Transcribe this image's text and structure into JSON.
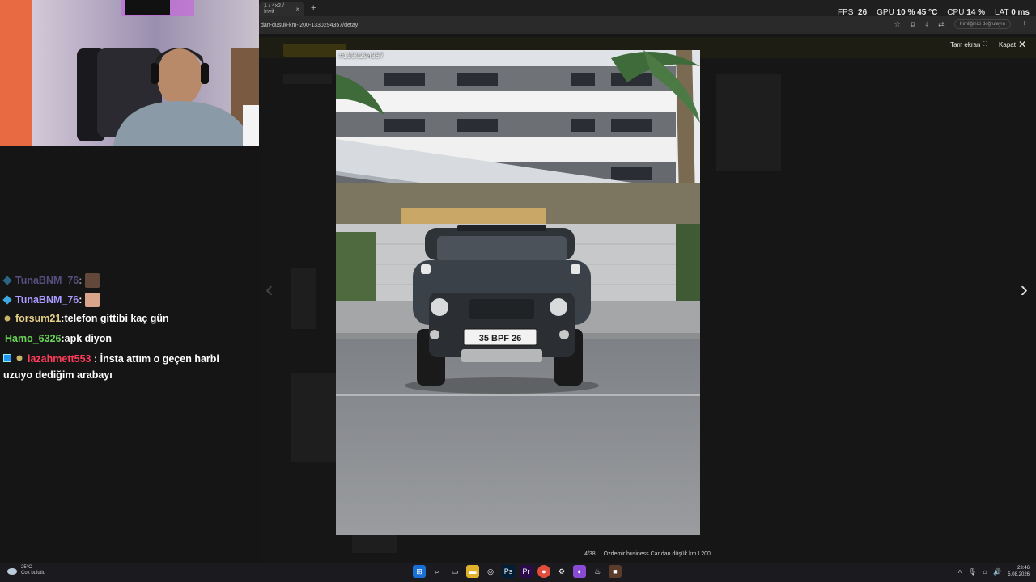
{
  "browser": {
    "tab_title": "1 / 4x2 / İnvit",
    "tab_close": "×",
    "new_tab": "+",
    "url": "dan-dusuk-km-l200-1330294357/detay",
    "profile_label": "Kimliğinizi doğrulayın"
  },
  "stats": {
    "fps_label": "FPS",
    "fps_value": "26",
    "gpu_label": "GPU",
    "gpu_value": "10 %",
    "gpu_temp": "45 °C",
    "cpu_label": "CPU",
    "cpu_value": "14 %",
    "lat_label": "LAT",
    "lat_value": "0 ms"
  },
  "lightbox": {
    "fullscreen_label": "Tam ekran",
    "close_label": "Kapat",
    "photo_id": "#1330294357",
    "counter": "4/38",
    "caption": "Özdemir business Car dan düşük km L200",
    "plate": "35 BPF 26"
  },
  "chat": {
    "messages": [
      {
        "user": "TunaBNM_76",
        "sep": " :",
        "text": "",
        "color": "#8a7fd8",
        "faded": true
      },
      {
        "user": "TunaBNM_76",
        "sep": " :",
        "text": "",
        "color": "#a99bff",
        "faded": false
      },
      {
        "user": "forsum21",
        "sep": " : ",
        "text": "telefon gittibi kaç gün",
        "color": "#e8d28a"
      },
      {
        "user": "Hamo_6326",
        "sep": " : ",
        "text": "apk diyon",
        "color": "#6bd65a"
      },
      {
        "user": "lazahmett553",
        "sep": " : ",
        "text": "İnsta attım o geçen harbi uzuyo dediğim arabayı",
        "color": "#ff3d5a"
      }
    ]
  },
  "taskbar": {
    "weather_temp": "25°C",
    "weather_desc": "Çok bulutlu",
    "time": "23:46",
    "date": "5.08.2026"
  }
}
